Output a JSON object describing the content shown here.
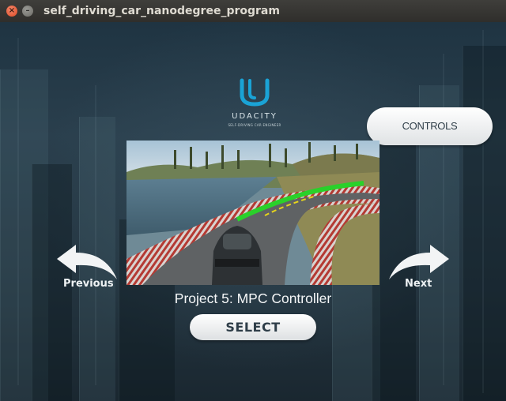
{
  "window": {
    "title": "self_driving_car_nanodegree_program",
    "close_glyph": "×",
    "minimize_glyph": "–"
  },
  "logo": {
    "wordmark": "UDACITY",
    "tagline": "SELF-DRIVING CAR ENGINEER"
  },
  "controls_button": {
    "label": "CONTROLS"
  },
  "navigation": {
    "previous_label": "Previous",
    "next_label": "Next"
  },
  "project": {
    "title": "Project 5: MPC Controller"
  },
  "select_button": {
    "label": "SELECT"
  },
  "colors": {
    "background": "#243541",
    "brand": "#1aa3d6",
    "button_fill": "#f2f3f4",
    "button_text": "#2e3d48"
  }
}
